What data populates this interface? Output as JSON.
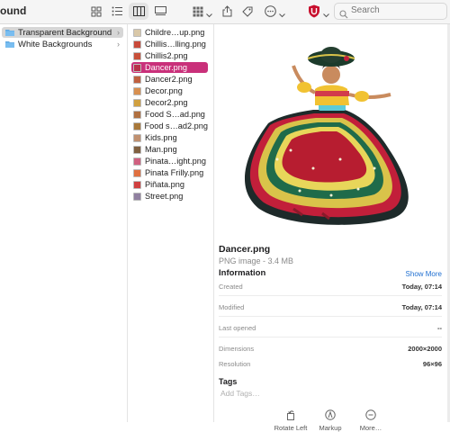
{
  "window": {
    "title": "ound"
  },
  "toolbar": {
    "view_icon": "icon-view-icon",
    "list_icon": "list-view-icon",
    "columns_icon": "column-view-icon",
    "gallery_icon": "gallery-view-icon",
    "group_icon": "group-icon",
    "share_icon": "share-icon",
    "tag_icon": "tag-icon",
    "more_icon": "more-icon",
    "extension_icon": "shield-extension-icon",
    "accent": "#c8102e",
    "search_placeholder": "Search"
  },
  "folders": [
    {
      "label": "Transparent Background",
      "selected": true
    },
    {
      "label": "White Backgrounds",
      "selected": false
    }
  ],
  "files": [
    {
      "name": "Childre…up.png",
      "selected": false,
      "thumb": "#d9c8a8"
    },
    {
      "name": "Chillis…lling.png",
      "selected": false,
      "thumb": "#c84a3a"
    },
    {
      "name": "Chillis2.png",
      "selected": false,
      "thumb": "#c8503a"
    },
    {
      "name": "Dancer.png",
      "selected": true,
      "thumb": "#b8304a"
    },
    {
      "name": "Dancer2.png",
      "selected": false,
      "thumb": "#c06040"
    },
    {
      "name": "Decor.png",
      "selected": false,
      "thumb": "#d89050"
    },
    {
      "name": "Decor2.png",
      "selected": false,
      "thumb": "#d0a040"
    },
    {
      "name": "Food S…ad.png",
      "selected": false,
      "thumb": "#b07040"
    },
    {
      "name": "Food s…ad2.png",
      "selected": false,
      "thumb": "#a8783a"
    },
    {
      "name": "Kids.png",
      "selected": false,
      "thumb": "#c09070"
    },
    {
      "name": "Man.png",
      "selected": false,
      "thumb": "#806040"
    },
    {
      "name": "Pinata…ight.png",
      "selected": false,
      "thumb": "#d06080"
    },
    {
      "name": "Pinata Frilly.png",
      "selected": false,
      "thumb": "#e07040"
    },
    {
      "name": "Piñata.png",
      "selected": false,
      "thumb": "#d04040"
    },
    {
      "name": "Street.png",
      "selected": false,
      "thumb": "#9080a0"
    }
  ],
  "preview": {
    "filename": "Dancer.png",
    "type": "PNG image - 3.4 MB",
    "info_heading": "Information",
    "show_more": "Show More",
    "info": [
      {
        "key": "Created",
        "value": "Today, 07:14"
      },
      {
        "key": "Modified",
        "value": "Today, 07:14"
      },
      {
        "key": "Last opened",
        "value": "--"
      },
      {
        "key": "Dimensions",
        "value": "2000×2000"
      },
      {
        "key": "Resolution",
        "value": "96×96"
      }
    ],
    "tags_heading": "Tags",
    "add_tags": "Add Tags…",
    "actions": [
      {
        "label": "Rotate Left",
        "icon": "rotate-left-icon"
      },
      {
        "label": "Markup",
        "icon": "markup-icon"
      },
      {
        "label": "More…",
        "icon": "more-actions-icon"
      }
    ]
  }
}
